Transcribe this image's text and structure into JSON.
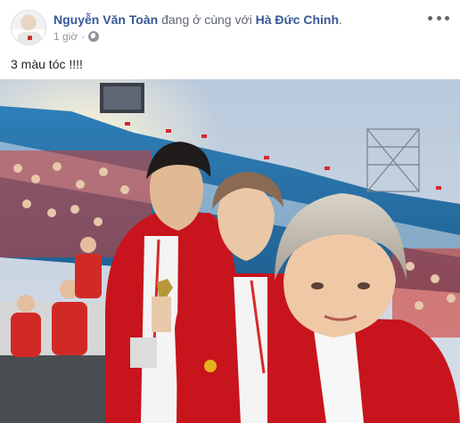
{
  "post": {
    "author": "Nguyễn Văn Toàn",
    "activity": "đang ở cùng với",
    "tagged": "Hà Đức Chinh",
    "time": "1 giờ",
    "separator": "·",
    "text": "3 màu tóc !!!!"
  },
  "icons": {
    "privacy": "globe-icon",
    "menu": "more-options-icon"
  },
  "colors": {
    "link": "#385898",
    "meta": "#90949c",
    "jacket_red": "#c8141c"
  }
}
